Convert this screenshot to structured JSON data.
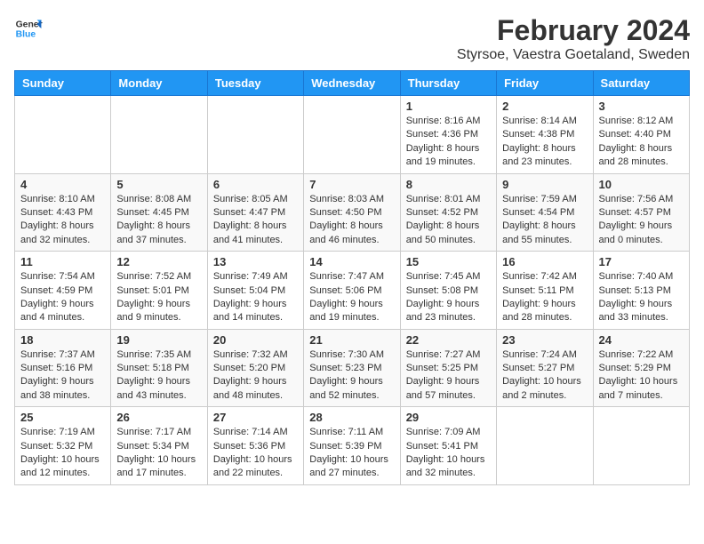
{
  "logo": {
    "line1": "General",
    "line2": "Blue"
  },
  "title": "February 2024",
  "subtitle": "Styrsoe, Vaestra Goetaland, Sweden",
  "days_header": [
    "Sunday",
    "Monday",
    "Tuesday",
    "Wednesday",
    "Thursday",
    "Friday",
    "Saturday"
  ],
  "weeks": [
    [
      {
        "day": "",
        "info": ""
      },
      {
        "day": "",
        "info": ""
      },
      {
        "day": "",
        "info": ""
      },
      {
        "day": "",
        "info": ""
      },
      {
        "day": "1",
        "info": "Sunrise: 8:16 AM\nSunset: 4:36 PM\nDaylight: 8 hours\nand 19 minutes."
      },
      {
        "day": "2",
        "info": "Sunrise: 8:14 AM\nSunset: 4:38 PM\nDaylight: 8 hours\nand 23 minutes."
      },
      {
        "day": "3",
        "info": "Sunrise: 8:12 AM\nSunset: 4:40 PM\nDaylight: 8 hours\nand 28 minutes."
      }
    ],
    [
      {
        "day": "4",
        "info": "Sunrise: 8:10 AM\nSunset: 4:43 PM\nDaylight: 8 hours\nand 32 minutes."
      },
      {
        "day": "5",
        "info": "Sunrise: 8:08 AM\nSunset: 4:45 PM\nDaylight: 8 hours\nand 37 minutes."
      },
      {
        "day": "6",
        "info": "Sunrise: 8:05 AM\nSunset: 4:47 PM\nDaylight: 8 hours\nand 41 minutes."
      },
      {
        "day": "7",
        "info": "Sunrise: 8:03 AM\nSunset: 4:50 PM\nDaylight: 8 hours\nand 46 minutes."
      },
      {
        "day": "8",
        "info": "Sunrise: 8:01 AM\nSunset: 4:52 PM\nDaylight: 8 hours\nand 50 minutes."
      },
      {
        "day": "9",
        "info": "Sunrise: 7:59 AM\nSunset: 4:54 PM\nDaylight: 8 hours\nand 55 minutes."
      },
      {
        "day": "10",
        "info": "Sunrise: 7:56 AM\nSunset: 4:57 PM\nDaylight: 9 hours\nand 0 minutes."
      }
    ],
    [
      {
        "day": "11",
        "info": "Sunrise: 7:54 AM\nSunset: 4:59 PM\nDaylight: 9 hours\nand 4 minutes."
      },
      {
        "day": "12",
        "info": "Sunrise: 7:52 AM\nSunset: 5:01 PM\nDaylight: 9 hours\nand 9 minutes."
      },
      {
        "day": "13",
        "info": "Sunrise: 7:49 AM\nSunset: 5:04 PM\nDaylight: 9 hours\nand 14 minutes."
      },
      {
        "day": "14",
        "info": "Sunrise: 7:47 AM\nSunset: 5:06 PM\nDaylight: 9 hours\nand 19 minutes."
      },
      {
        "day": "15",
        "info": "Sunrise: 7:45 AM\nSunset: 5:08 PM\nDaylight: 9 hours\nand 23 minutes."
      },
      {
        "day": "16",
        "info": "Sunrise: 7:42 AM\nSunset: 5:11 PM\nDaylight: 9 hours\nand 28 minutes."
      },
      {
        "day": "17",
        "info": "Sunrise: 7:40 AM\nSunset: 5:13 PM\nDaylight: 9 hours\nand 33 minutes."
      }
    ],
    [
      {
        "day": "18",
        "info": "Sunrise: 7:37 AM\nSunset: 5:16 PM\nDaylight: 9 hours\nand 38 minutes."
      },
      {
        "day": "19",
        "info": "Sunrise: 7:35 AM\nSunset: 5:18 PM\nDaylight: 9 hours\nand 43 minutes."
      },
      {
        "day": "20",
        "info": "Sunrise: 7:32 AM\nSunset: 5:20 PM\nDaylight: 9 hours\nand 48 minutes."
      },
      {
        "day": "21",
        "info": "Sunrise: 7:30 AM\nSunset: 5:23 PM\nDaylight: 9 hours\nand 52 minutes."
      },
      {
        "day": "22",
        "info": "Sunrise: 7:27 AM\nSunset: 5:25 PM\nDaylight: 9 hours\nand 57 minutes."
      },
      {
        "day": "23",
        "info": "Sunrise: 7:24 AM\nSunset: 5:27 PM\nDaylight: 10 hours\nand 2 minutes."
      },
      {
        "day": "24",
        "info": "Sunrise: 7:22 AM\nSunset: 5:29 PM\nDaylight: 10 hours\nand 7 minutes."
      }
    ],
    [
      {
        "day": "25",
        "info": "Sunrise: 7:19 AM\nSunset: 5:32 PM\nDaylight: 10 hours\nand 12 minutes."
      },
      {
        "day": "26",
        "info": "Sunrise: 7:17 AM\nSunset: 5:34 PM\nDaylight: 10 hours\nand 17 minutes."
      },
      {
        "day": "27",
        "info": "Sunrise: 7:14 AM\nSunset: 5:36 PM\nDaylight: 10 hours\nand 22 minutes."
      },
      {
        "day": "28",
        "info": "Sunrise: 7:11 AM\nSunset: 5:39 PM\nDaylight: 10 hours\nand 27 minutes."
      },
      {
        "day": "29",
        "info": "Sunrise: 7:09 AM\nSunset: 5:41 PM\nDaylight: 10 hours\nand 32 minutes."
      },
      {
        "day": "",
        "info": ""
      },
      {
        "day": "",
        "info": ""
      }
    ]
  ]
}
